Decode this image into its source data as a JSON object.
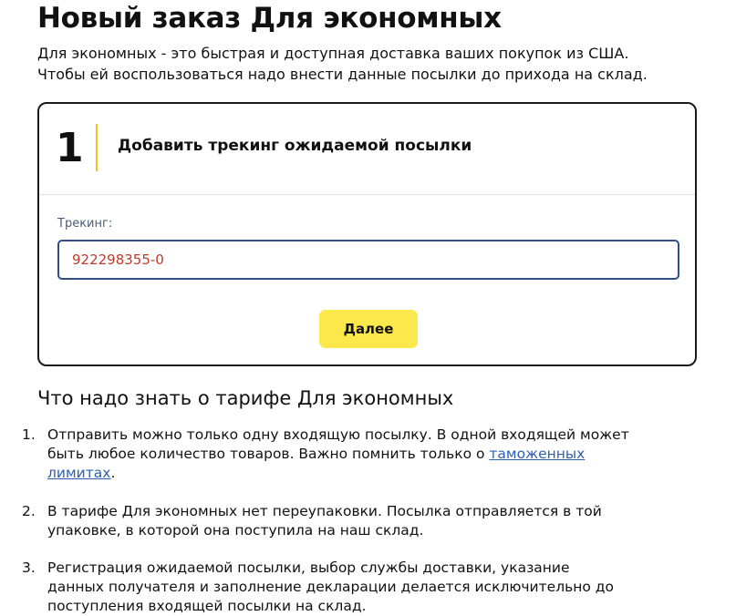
{
  "page": {
    "title": "Новый заказ Для экономных",
    "intro_line1": "Для экономных - это быстрая и доступная доставка ваших покупок из США.",
    "intro_line2": "Чтобы ей воспользоваться надо внести данные посылки до прихода на склад."
  },
  "step": {
    "number": "1",
    "title": "Добавить трекинг ожидаемой посылки",
    "tracking_label": "Трекинг:",
    "tracking_value": "922298355-0",
    "next_label": "Далее"
  },
  "info": {
    "heading": "Что надо знать о тарифе Для экономных",
    "items": [
      {
        "number": "1.",
        "line1": "Отправить можно только одну входящую посылку. В одной входящей может",
        "line2_prefix": "быть любое количество товаров. Важно помнить только о ",
        "link_part1": "таможенных",
        "link_part2": "лимитах",
        "suffix": "."
      },
      {
        "number": "2.",
        "line1": "В тарифе Для экономных нет переупаковки. Посылка отправляется в той",
        "line2": "упаковке, в которой она поступила на наш склад."
      },
      {
        "number": "3.",
        "line1": "Регистрация ожидаемой посылки, выбор службы доставки, указание",
        "line2": "данных получателя и заполнение декларации делается исключительно до",
        "line3": "поступления входящей посылки на склад."
      }
    ]
  },
  "colors": {
    "accent_yellow": "#fbe84a",
    "divider_yellow": "#f2c21b",
    "input_border": "#2f4f86",
    "tracking_text": "#c0392b",
    "link": "#2f5fb3"
  }
}
